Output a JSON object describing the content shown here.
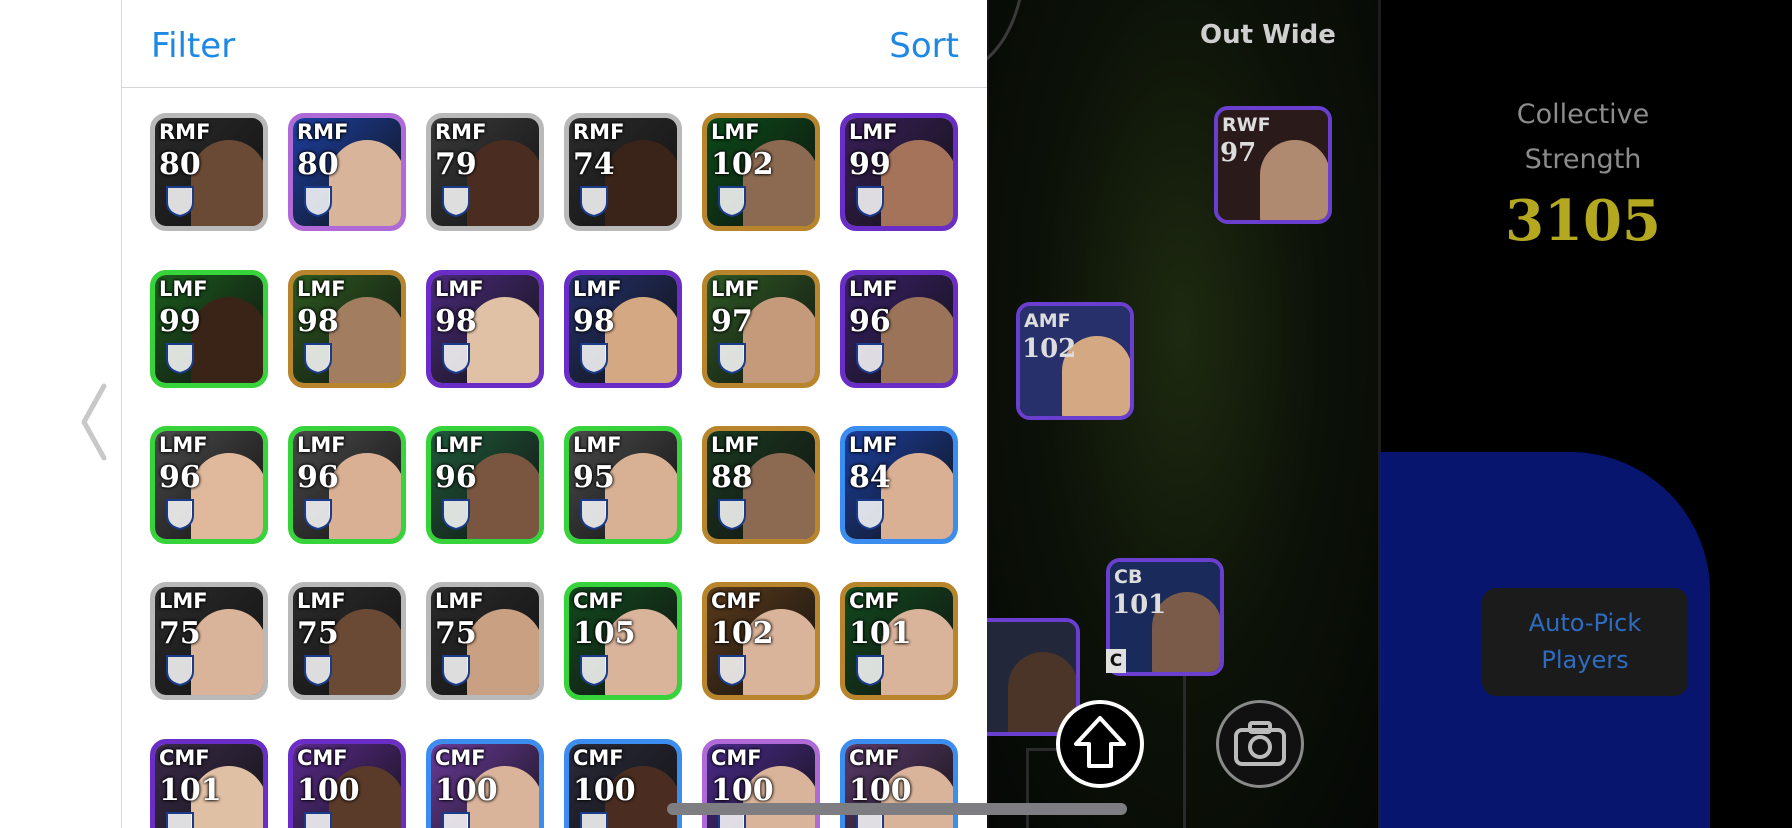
{
  "panel": {
    "filter_label": "Filter",
    "sort_label": "Sort"
  },
  "players": [
    {
      "pos": "RMF",
      "rating": "80",
      "frame": "#b9b9b9",
      "bg": "#2a2a2a",
      "skin": "#6b4a35"
    },
    {
      "pos": "RMF",
      "rating": "80",
      "frame": "#b06ad8",
      "bg": "#1c3fa0",
      "skin": "#d8b49a"
    },
    {
      "pos": "RMF",
      "rating": "79",
      "frame": "#b9b9b9",
      "bg": "#3a3a3a",
      "skin": "#4a2d20"
    },
    {
      "pos": "RMF",
      "rating": "74",
      "frame": "#b9b9b9",
      "bg": "#2b2b2b",
      "skin": "#3a241a"
    },
    {
      "pos": "LMF",
      "rating": "102",
      "frame": "#b8852c",
      "bg": "#0b4b18",
      "skin": "#8c6a52"
    },
    {
      "pos": "LMF",
      "rating": "99",
      "frame": "#6a2dc8",
      "bg": "#3a1f5a",
      "skin": "#a5735a"
    },
    {
      "pos": "LMF",
      "rating": "99",
      "frame": "#37d33b",
      "bg": "#1b5a1d",
      "skin": "#3a2418"
    },
    {
      "pos": "LMF",
      "rating": "98",
      "frame": "#b8852c",
      "bg": "#2d5a20",
      "skin": "#a37d60"
    },
    {
      "pos": "LMF",
      "rating": "98",
      "frame": "#6a2dc8",
      "bg": "#4a2a7a",
      "skin": "#e1c1a5"
    },
    {
      "pos": "LMF",
      "rating": "98",
      "frame": "#6a2dc8",
      "bg": "#23306a",
      "skin": "#d4a882"
    },
    {
      "pos": "LMF",
      "rating": "97",
      "frame": "#b8852c",
      "bg": "#2e5a24",
      "skin": "#c49a7a"
    },
    {
      "pos": "LMF",
      "rating": "96",
      "frame": "#6a2dc8",
      "bg": "#3a206a",
      "skin": "#9a7358"
    },
    {
      "pos": "LMF",
      "rating": "96",
      "frame": "#37d33b",
      "bg": "#4a4a4a",
      "skin": "#e0b89c"
    },
    {
      "pos": "LMF",
      "rating": "96",
      "frame": "#37d33b",
      "bg": "#4a4a4a",
      "skin": "#d9b094"
    },
    {
      "pos": "LMF",
      "rating": "96",
      "frame": "#37d33b",
      "bg": "#1f5a3a",
      "skin": "#7a5540"
    },
    {
      "pos": "LMF",
      "rating": "95",
      "frame": "#37d33b",
      "bg": "#4a4a4a",
      "skin": "#d8b094"
    },
    {
      "pos": "LMF",
      "rating": "88",
      "frame": "#b8852c",
      "bg": "#1b3a20",
      "skin": "#8c6a52"
    },
    {
      "pos": "LMF",
      "rating": "84",
      "frame": "#3b8ef0",
      "bg": "#1c3fa0",
      "skin": "#d9b094"
    },
    {
      "pos": "LMF",
      "rating": "75",
      "frame": "#b9b9b9",
      "bg": "#2b2b2b",
      "skin": "#d9b39a"
    },
    {
      "pos": "LMF",
      "rating": "75",
      "frame": "#b9b9b9",
      "bg": "#2b2b2b",
      "skin": "#6b4a35"
    },
    {
      "pos": "LMF",
      "rating": "75",
      "frame": "#b9b9b9",
      "bg": "#2b2b2b",
      "skin": "#c9a082"
    },
    {
      "pos": "CMF",
      "rating": "105",
      "frame": "#37d33b",
      "bg": "#124a1e",
      "skin": "#d9b39a"
    },
    {
      "pos": "CMF",
      "rating": "102",
      "frame": "#b8852c",
      "bg": "#5a3a1a",
      "skin": "#d9b39a"
    },
    {
      "pos": "CMF",
      "rating": "101",
      "frame": "#b8852c",
      "bg": "#124a1e",
      "skin": "#d9b39a"
    },
    {
      "pos": "CMF",
      "rating": "101",
      "frame": "#6a2dc8",
      "bg": "#3a2a4a",
      "skin": "#e0c0a5"
    },
    {
      "pos": "CMF",
      "rating": "100",
      "frame": "#6a2dc8",
      "bg": "#5a2a8a",
      "skin": "#5a3a28"
    },
    {
      "pos": "CMF",
      "rating": "100",
      "frame": "#3b8ef0",
      "bg": "#6a3a9a",
      "skin": "#d9b39a"
    },
    {
      "pos": "CMF",
      "rating": "100",
      "frame": "#3b8ef0",
      "bg": "#2a2a3a",
      "skin": "#4a2d20"
    },
    {
      "pos": "CMF",
      "rating": "100",
      "frame": "#b06ad8",
      "bg": "#4a2a8a",
      "skin": "#d9b39a"
    },
    {
      "pos": "CMF",
      "rating": "100",
      "frame": "#3b8ef0",
      "bg": "#5a3a6a",
      "skin": "#d9b39a"
    }
  ],
  "pitch": {
    "mode_label": "Out Wide",
    "players": [
      {
        "pos": "RWF",
        "rating": "97"
      },
      {
        "pos": "AMF",
        "rating": "102"
      },
      {
        "pos": "CB",
        "rating": "101"
      }
    ],
    "captain_label": "C"
  },
  "sidebar": {
    "strength_label": "Collective\nStrength",
    "strength_value": "3105",
    "autopick_label": "Auto-Pick\nPlayers"
  }
}
